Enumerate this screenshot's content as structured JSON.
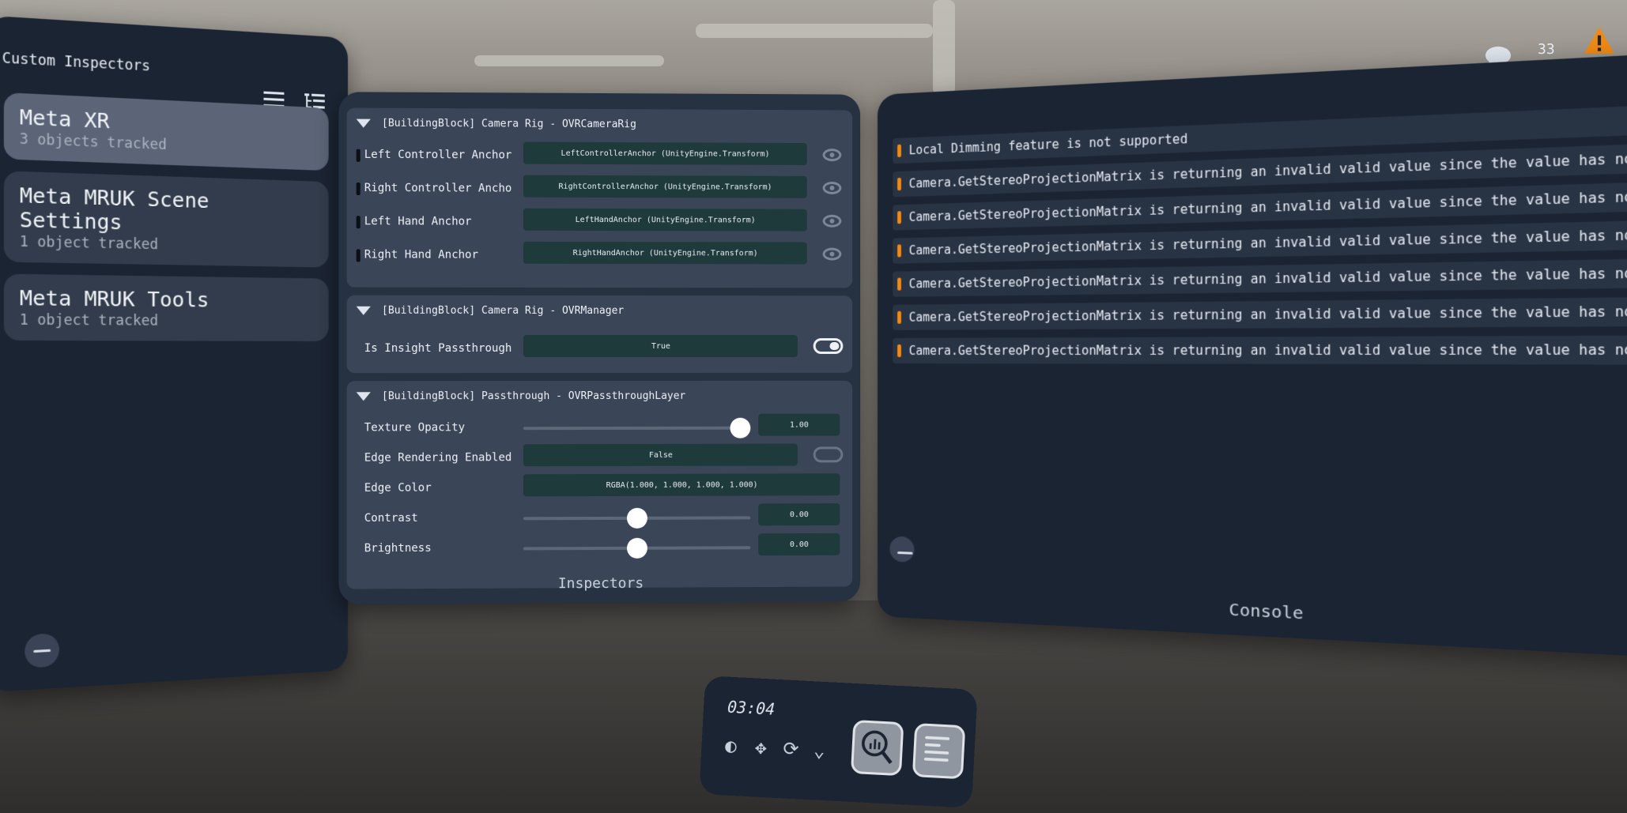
{
  "left_panel": {
    "title": "Custom Inspectors",
    "items": [
      {
        "name": "Meta XR",
        "sub": "3 objects tracked"
      },
      {
        "name": "Meta MRUK Scene Settings",
        "sub": "1 object tracked"
      },
      {
        "name": "Meta MRUK Tools",
        "sub": "1 object tracked"
      }
    ]
  },
  "inspectors": {
    "footer": "Inspectors",
    "camera_rig": {
      "header": "[BuildingBlock] Camera Rig - OVRCameraRig",
      "rows": [
        {
          "label": "Left Controller Anchor",
          "value": "LeftControllerAnchor (UnityEngine.Transform)"
        },
        {
          "label": "Right Controller Ancho",
          "value": "RightControllerAnchor (UnityEngine.Transform)"
        },
        {
          "label": "Left Hand Anchor",
          "value": "LeftHandAnchor (UnityEngine.Transform)"
        },
        {
          "label": "Right Hand Anchor",
          "value": "RightHandAnchor (UnityEngine.Transform)"
        }
      ]
    },
    "manager": {
      "header": "[BuildingBlock] Camera Rig - OVRManager",
      "label": "Is Insight Passthrough",
      "value": "True",
      "toggle_on": true
    },
    "passthrough": {
      "header": "[BuildingBlock] Passthrough - OVRPassthroughLayer",
      "texture_opacity": {
        "label": "Texture Opacity",
        "value": "1.00",
        "level": 1.0
      },
      "edge_rendering": {
        "label": "Edge Rendering Enabled",
        "value": "False",
        "toggle_on": false
      },
      "edge_color": {
        "label": "Edge Color",
        "value": "RGBA(1.000, 1.000, 1.000, 1.000)"
      },
      "contrast": {
        "label": "Contrast",
        "value": "0.00",
        "level": 0.5
      },
      "brightness": {
        "label": "Brightness",
        "value": "0.00",
        "level": 0.5
      }
    }
  },
  "console": {
    "footer": "Console",
    "count": "33",
    "logs": [
      "Local Dimming feature is not supported",
      "Camera.GetStereoProjectionMatrix is returning an invalid valid value since the value has not been set.",
      "Camera.GetStereoProjectionMatrix is returning an invalid valid value since the value has not been set.",
      "Camera.GetStereoProjectionMatrix is returning an invalid valid value since the value has not been set.",
      "Camera.GetStereoProjectionMatrix is returning an invalid valid value since the value has not been set.",
      "Camera.GetStereoProjectionMatrix is returning an invalid valid value since the value has not been set.",
      "Camera.GetStereoProjectionMatrix is returning an invalid valid value since the value has not been set."
    ],
    "warn_color": "#f08a14"
  },
  "dock": {
    "time": "03:04"
  }
}
